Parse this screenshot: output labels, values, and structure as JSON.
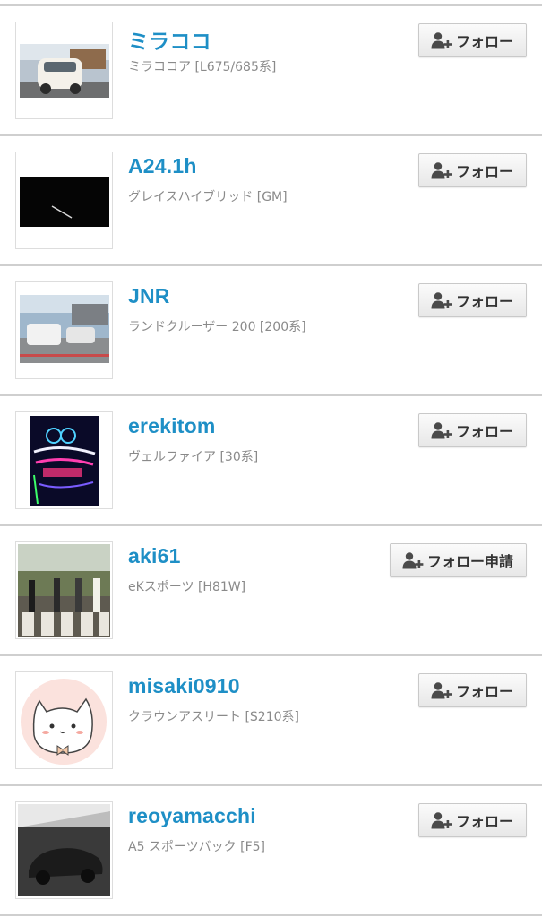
{
  "users": [
    {
      "username": "ミラココ",
      "car": "ミラココア [L675/685系]",
      "button_label": "フォロー",
      "avatar": "white-car-photo"
    },
    {
      "username": "A24.1h",
      "car": "グレイスハイブリッド [GM]",
      "button_label": "フォロー",
      "avatar": "dark-night-photo"
    },
    {
      "username": "JNR",
      "car": "ランドクルーザー 200 [200系]",
      "button_label": "フォロー",
      "avatar": "parking-lot-suv-photo"
    },
    {
      "username": "erekitom",
      "car": "ヴェルファイア [30系]",
      "button_label": "フォロー",
      "avatar": "neon-headlight-photo"
    },
    {
      "username": "aki61",
      "car": "eKスポーツ [H81W]",
      "button_label": "フォロー申請",
      "avatar": "crosswalk-photo"
    },
    {
      "username": "misaki0910",
      "car": "クラウンアスリート [S210系]",
      "button_label": "フォロー",
      "avatar": "cat-illustration"
    },
    {
      "username": "reoyamacchi",
      "car": "A5 スポーツバック [F5]",
      "button_label": "フォロー",
      "avatar": "dark-sportscar-photo"
    }
  ],
  "colors": {
    "username": "#1e8fc6",
    "subtext": "#8a8a8a",
    "divider": "#cfcfcf",
    "button_bg": "#f0f0f0"
  },
  "icons": {
    "follow_button": "add-user-icon"
  }
}
